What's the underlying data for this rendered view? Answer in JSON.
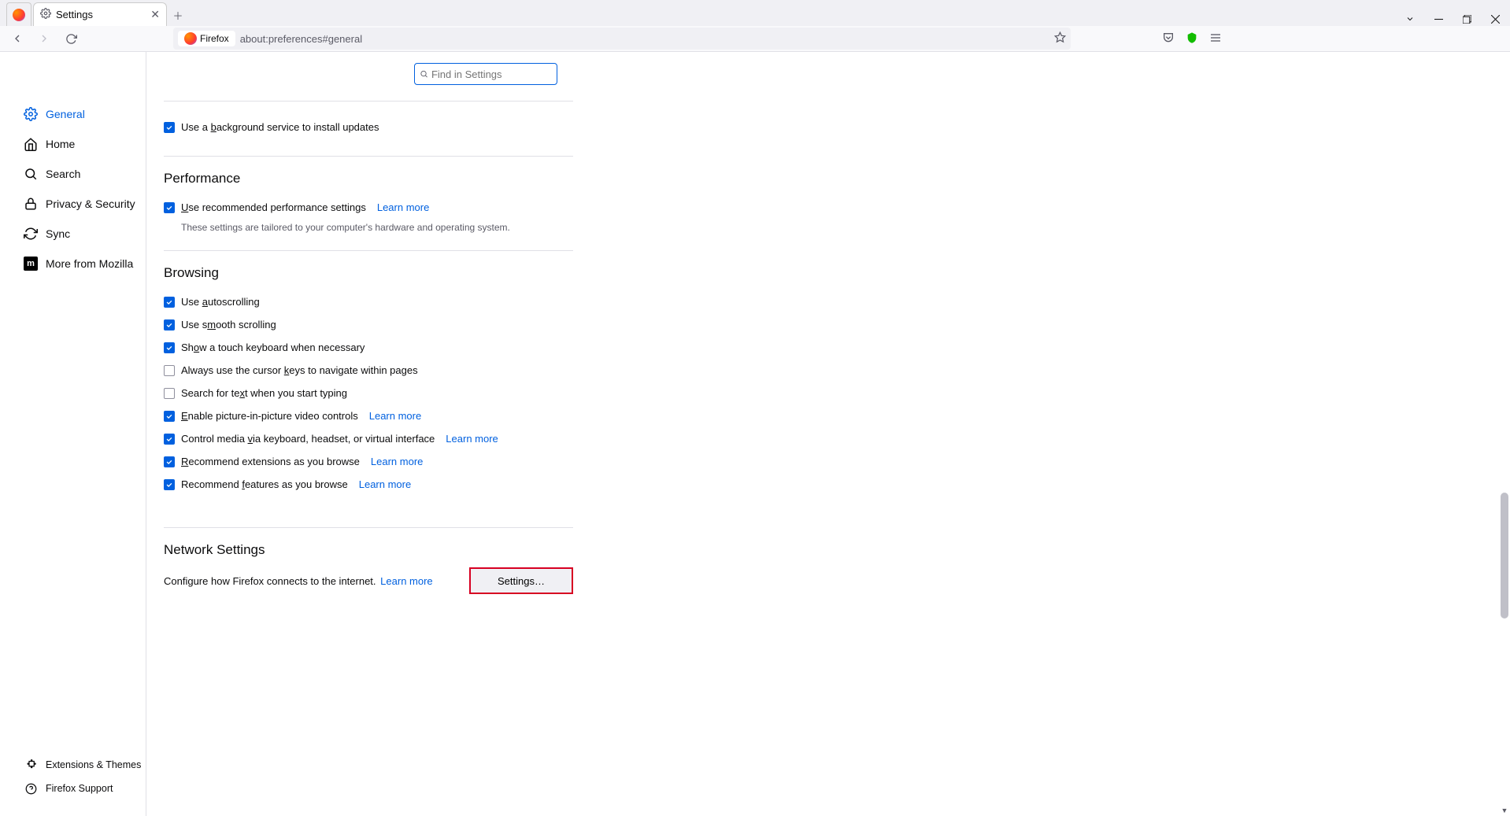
{
  "tab": {
    "title": "Settings"
  },
  "urlbar": {
    "firefox_label": "Firefox",
    "url": "about:preferences#general"
  },
  "sidebar": {
    "items": [
      {
        "label": "General"
      },
      {
        "label": "Home"
      },
      {
        "label": "Search"
      },
      {
        "label": "Privacy & Security"
      },
      {
        "label": "Sync"
      },
      {
        "label": "More from Mozilla"
      }
    ],
    "footer": [
      {
        "label": "Extensions & Themes"
      },
      {
        "label": "Firefox Support"
      }
    ]
  },
  "search": {
    "placeholder": "Find in Settings"
  },
  "sections": {
    "bg_service": {
      "label": "Use a background service to install updates"
    },
    "performance": {
      "title": "Performance",
      "rec_label": "Use recommended performance settings",
      "learn_more": "Learn more",
      "hint": "These settings are tailored to your computer's hardware and operating system."
    },
    "browsing": {
      "title": "Browsing",
      "items": [
        {
          "label": "Use autoscrolling",
          "checked": true
        },
        {
          "label": "Use smooth scrolling",
          "checked": true
        },
        {
          "label": "Show a touch keyboard when necessary",
          "checked": true
        },
        {
          "label": "Always use the cursor keys to navigate within pages",
          "checked": false
        },
        {
          "label": "Search for text when you start typing",
          "checked": false
        },
        {
          "label": "Enable picture-in-picture video controls",
          "checked": true,
          "learn": "Learn more"
        },
        {
          "label": "Control media via keyboard, headset, or virtual interface",
          "checked": true,
          "learn": "Learn more"
        },
        {
          "label": "Recommend extensions as you browse",
          "checked": true,
          "learn": "Learn more"
        },
        {
          "label": "Recommend features as you browse",
          "checked": true,
          "learn": "Learn more"
        }
      ]
    },
    "network": {
      "title": "Network Settings",
      "desc": "Configure how Firefox connects to the internet.",
      "learn_more": "Learn more",
      "button": "Settings…"
    }
  }
}
